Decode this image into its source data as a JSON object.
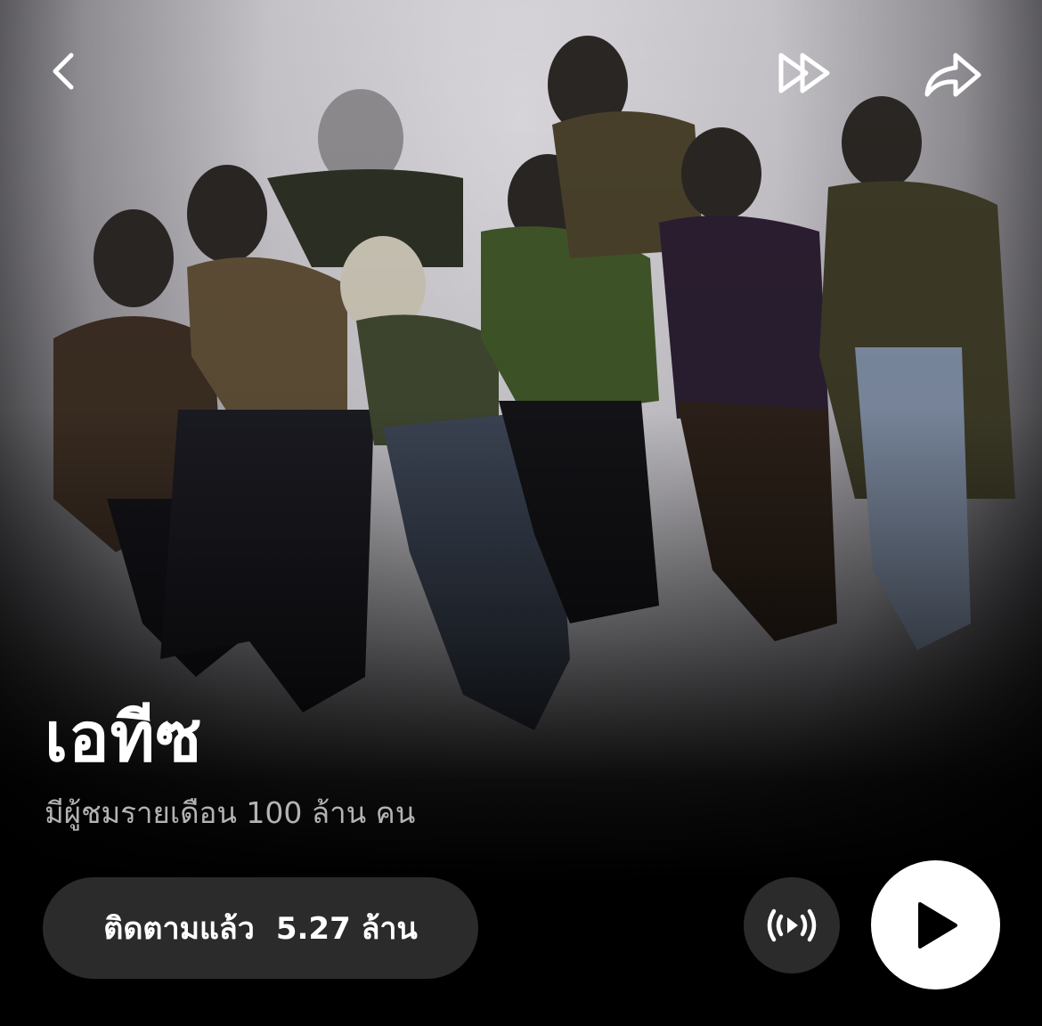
{
  "artist": {
    "name": "เอทีซ",
    "monthly_listeners": "มีผู้ชมรายเดือน 100 ล้าน คน"
  },
  "follow": {
    "label": "ติดตามแล้ว",
    "count": "5.27 ล้าน"
  },
  "icons": {
    "back": "chevron-left-icon",
    "skip": "fast-forward-icon",
    "share": "share-icon",
    "preview": "broadcast-play-icon",
    "play": "play-icon"
  },
  "colors": {
    "background": "#000000",
    "button_bg": "#2b2b2b",
    "play_bg": "#ffffff",
    "subtitle": "#b3b3b3"
  }
}
